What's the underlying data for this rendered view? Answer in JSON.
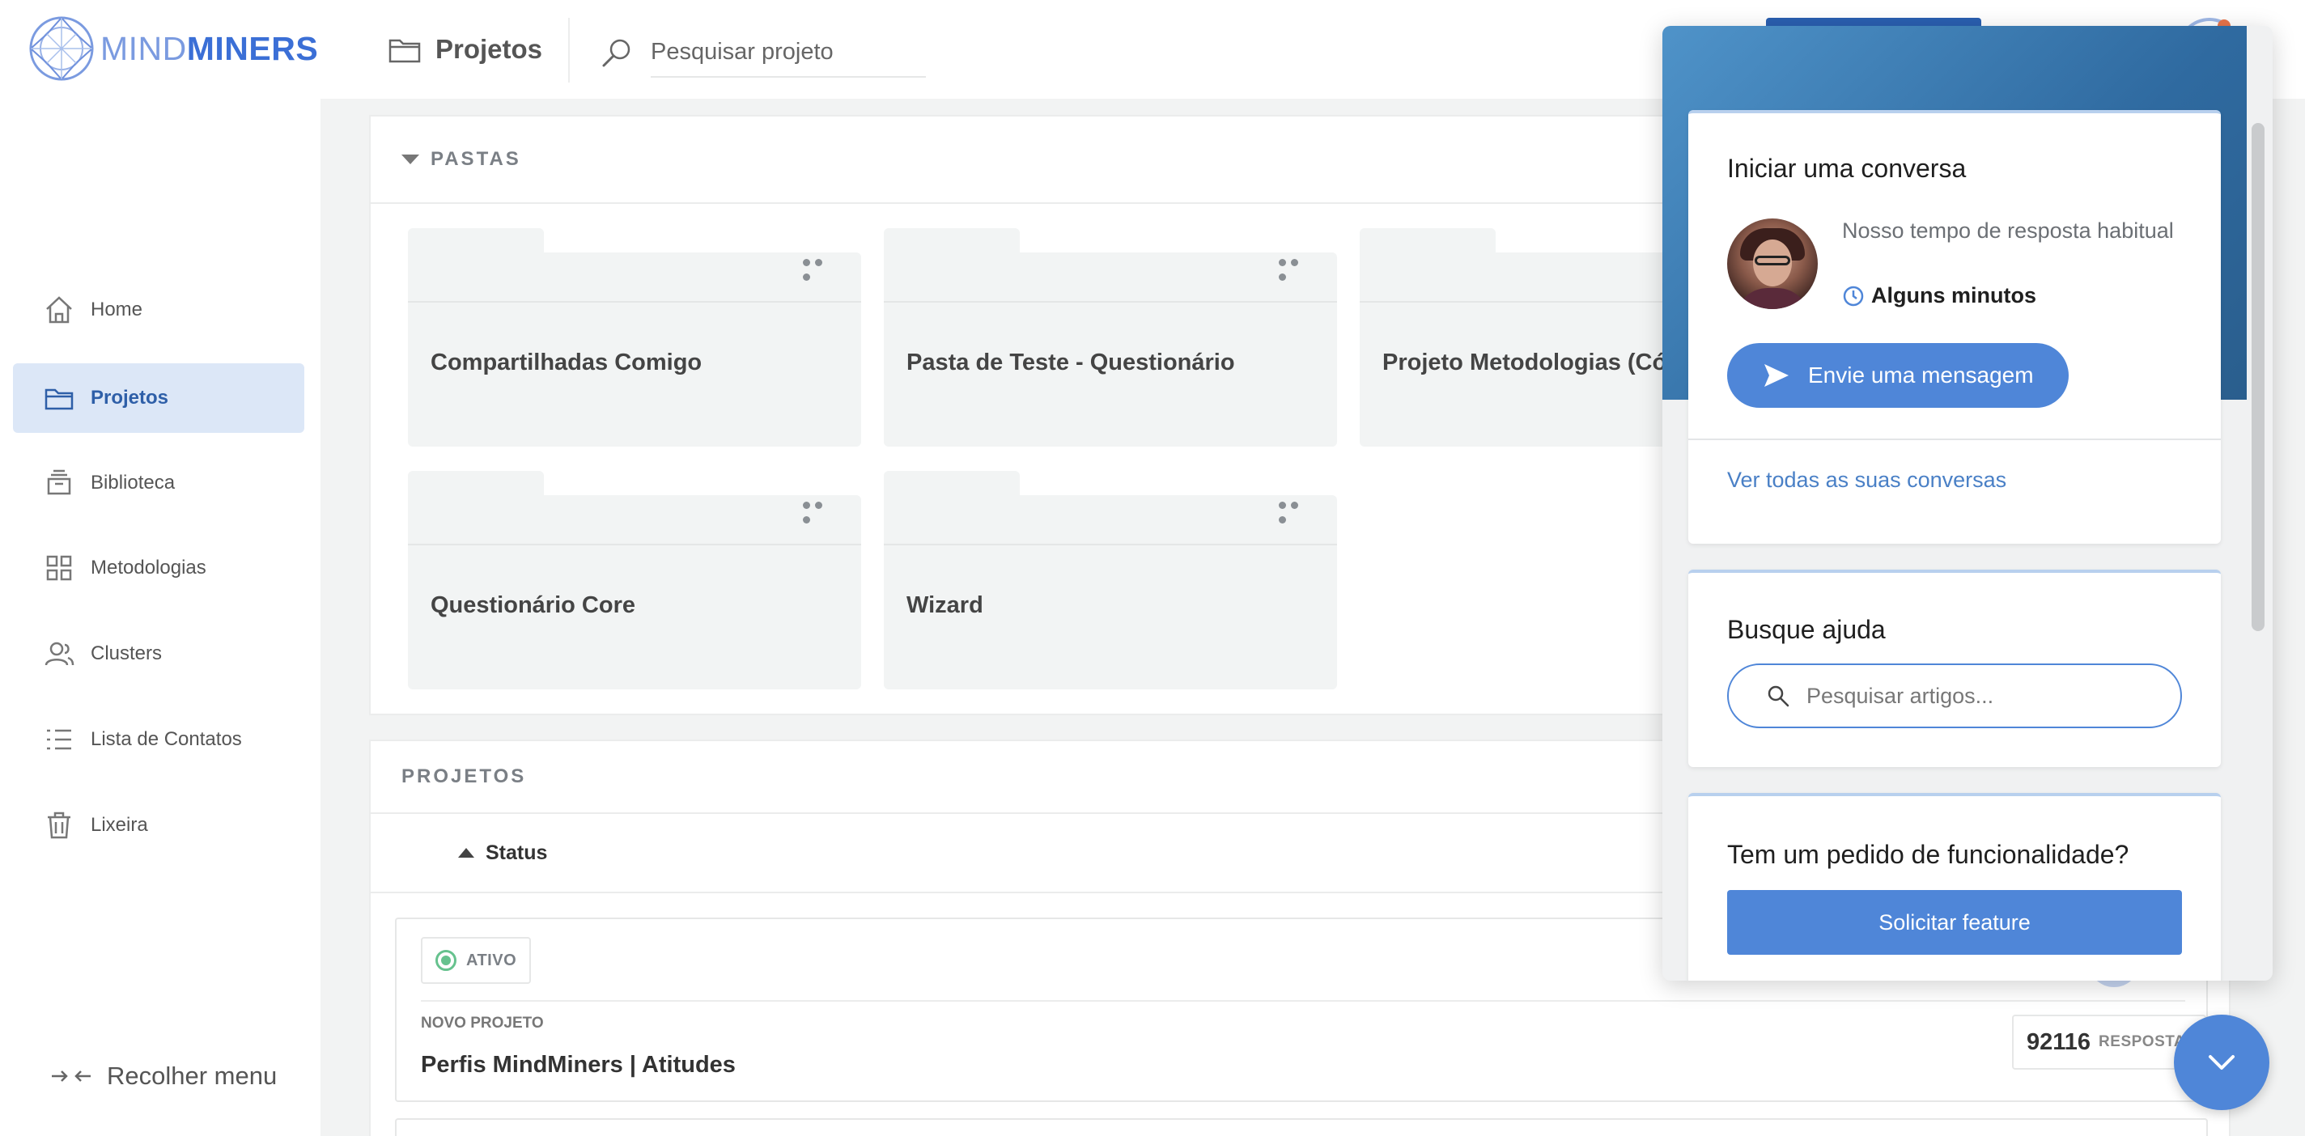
{
  "brand": {
    "mind": "MIND",
    "miners": "MINERS"
  },
  "header": {
    "breadcrumb": "Projetos",
    "search_placeholder": "Pesquisar projeto"
  },
  "sidebar": {
    "items": [
      {
        "label": "Home",
        "icon": "home-icon",
        "active": false
      },
      {
        "label": "Projetos",
        "icon": "folder-icon",
        "active": true
      },
      {
        "label": "Biblioteca",
        "icon": "library-icon",
        "active": false
      },
      {
        "label": "Metodologias",
        "icon": "grid-icon",
        "active": false
      },
      {
        "label": "Clusters",
        "icon": "users-icon",
        "active": false
      },
      {
        "label": "Lista de Contatos",
        "icon": "list-icon",
        "active": false
      },
      {
        "label": "Lixeira",
        "icon": "trash-icon",
        "active": false
      }
    ],
    "collapse_label": "Recolher menu"
  },
  "pastas": {
    "title": "PASTAS",
    "folders": [
      {
        "name": "Compartilhadas Comigo"
      },
      {
        "name": "Pasta de Teste - Questionário"
      },
      {
        "name": "Projeto Metodologias (Cópi"
      },
      {
        "name": "Questionário Core"
      },
      {
        "name": "Wizard"
      }
    ]
  },
  "projetos": {
    "title": "PROJETOS",
    "sort_label": "Status",
    "cards": [
      {
        "status": "ATIVO",
        "kind": "NOVO PROJETO",
        "title": "Perfis MindMiners | Atitudes",
        "responses": "92116",
        "responses_label": "RESPOSTA"
      }
    ]
  },
  "messenger": {
    "start": {
      "title": "Iniciar uma conversa",
      "response_text": "Nosso tempo de resposta habitual",
      "response_time": "Alguns minutos",
      "send_button": "Envie uma mensagem",
      "see_all": "Ver todas as suas conversas"
    },
    "help": {
      "title": "Busque ajuda",
      "search_placeholder": "Pesquisar artigos..."
    },
    "feature": {
      "title": "Tem um pedido de funcionalidade?",
      "button": "Solicitar feature"
    }
  },
  "colors": {
    "accent": "#4f86d8",
    "brand_blue": "#3b6fd6",
    "active_nav_bg": "#dce7f7",
    "status_green": "#66c28e"
  }
}
